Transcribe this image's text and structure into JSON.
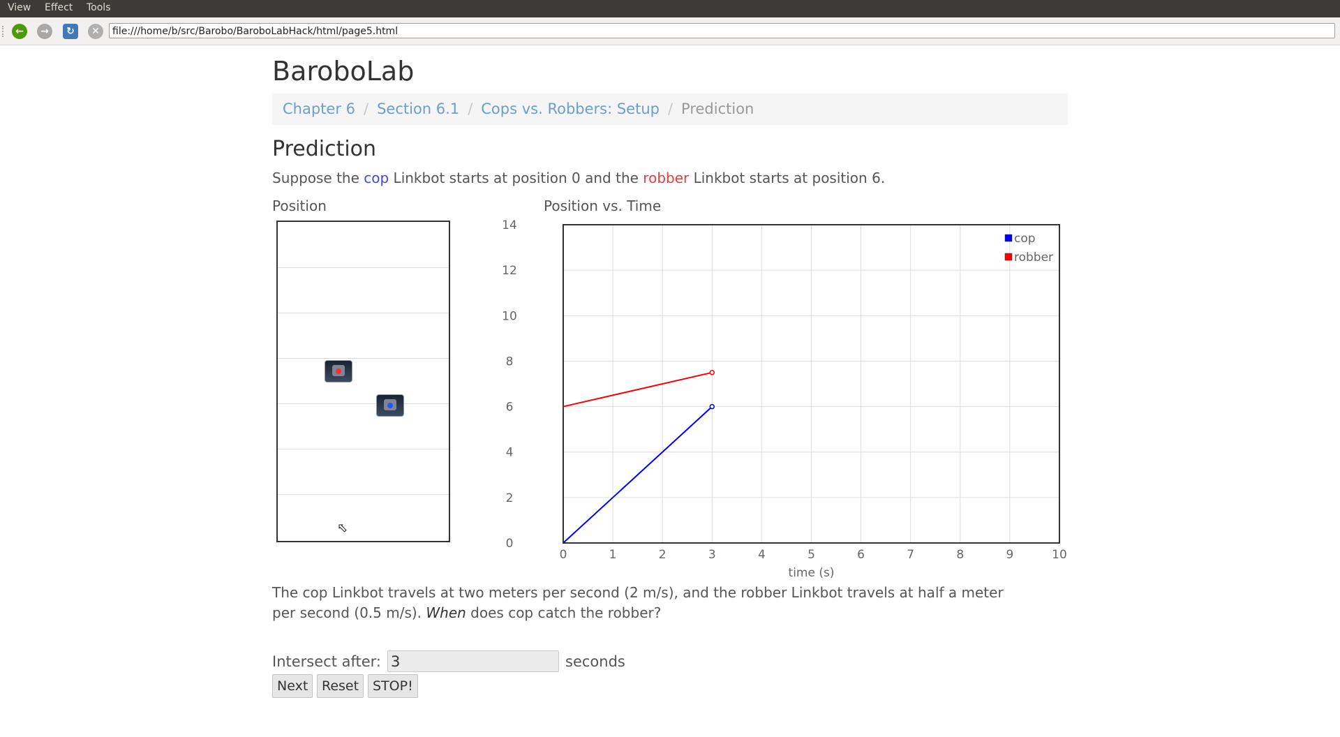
{
  "browser": {
    "menu": [
      "View",
      "Effect",
      "Tools"
    ],
    "url": "file:///home/b/src/Barobo/BaroboLabHack/html/page5.html"
  },
  "page": {
    "title": "BaroboLab",
    "breadcrumb": {
      "items": [
        "Chapter 6",
        "Section 6.1",
        "Cops vs. Robbers: Setup"
      ],
      "active": "Prediction",
      "separator": "/"
    },
    "heading": "Prediction",
    "intro": {
      "part1": "Suppose the ",
      "cop": "cop",
      "part2": " Linkbot starts at position 0 and the ",
      "robber": "robber",
      "part3": " Linkbot starts at position 6."
    },
    "position_label": "Position",
    "chart_label": "Position vs. Time",
    "question": {
      "line1": "The cop Linkbot travels at two meters per second (2 m/s), and the robber Linkbot travels at half a meter",
      "line2_pre": "per second (0.5 m/s). ",
      "line2_em": "When",
      "line2_post": " does cop catch the robber?"
    },
    "form": {
      "label": "Intersect after:",
      "value": "3",
      "unit": "seconds",
      "buttons": [
        "Next",
        "Reset",
        "STOP!"
      ]
    }
  },
  "colors": {
    "cop": "#0000ff",
    "robber": "#ff0000",
    "link": "#6e9ec9"
  },
  "chart_data": {
    "type": "line",
    "title": "Position vs. Time",
    "xlabel": "time (s)",
    "ylabel": "",
    "xlim": [
      0,
      10
    ],
    "ylim": [
      0,
      14
    ],
    "xticks": [
      0,
      1,
      2,
      3,
      4,
      5,
      6,
      7,
      8,
      9,
      10
    ],
    "yticks": [
      0,
      2,
      4,
      6,
      8,
      10,
      12,
      14
    ],
    "grid": true,
    "legend": "top-right",
    "series": [
      {
        "name": "cop",
        "color": "#0000ff",
        "x": [
          0,
          3
        ],
        "y": [
          0,
          6
        ]
      },
      {
        "name": "robber",
        "color": "#ff0000",
        "x": [
          0,
          3
        ],
        "y": [
          6,
          7.5
        ]
      }
    ]
  }
}
